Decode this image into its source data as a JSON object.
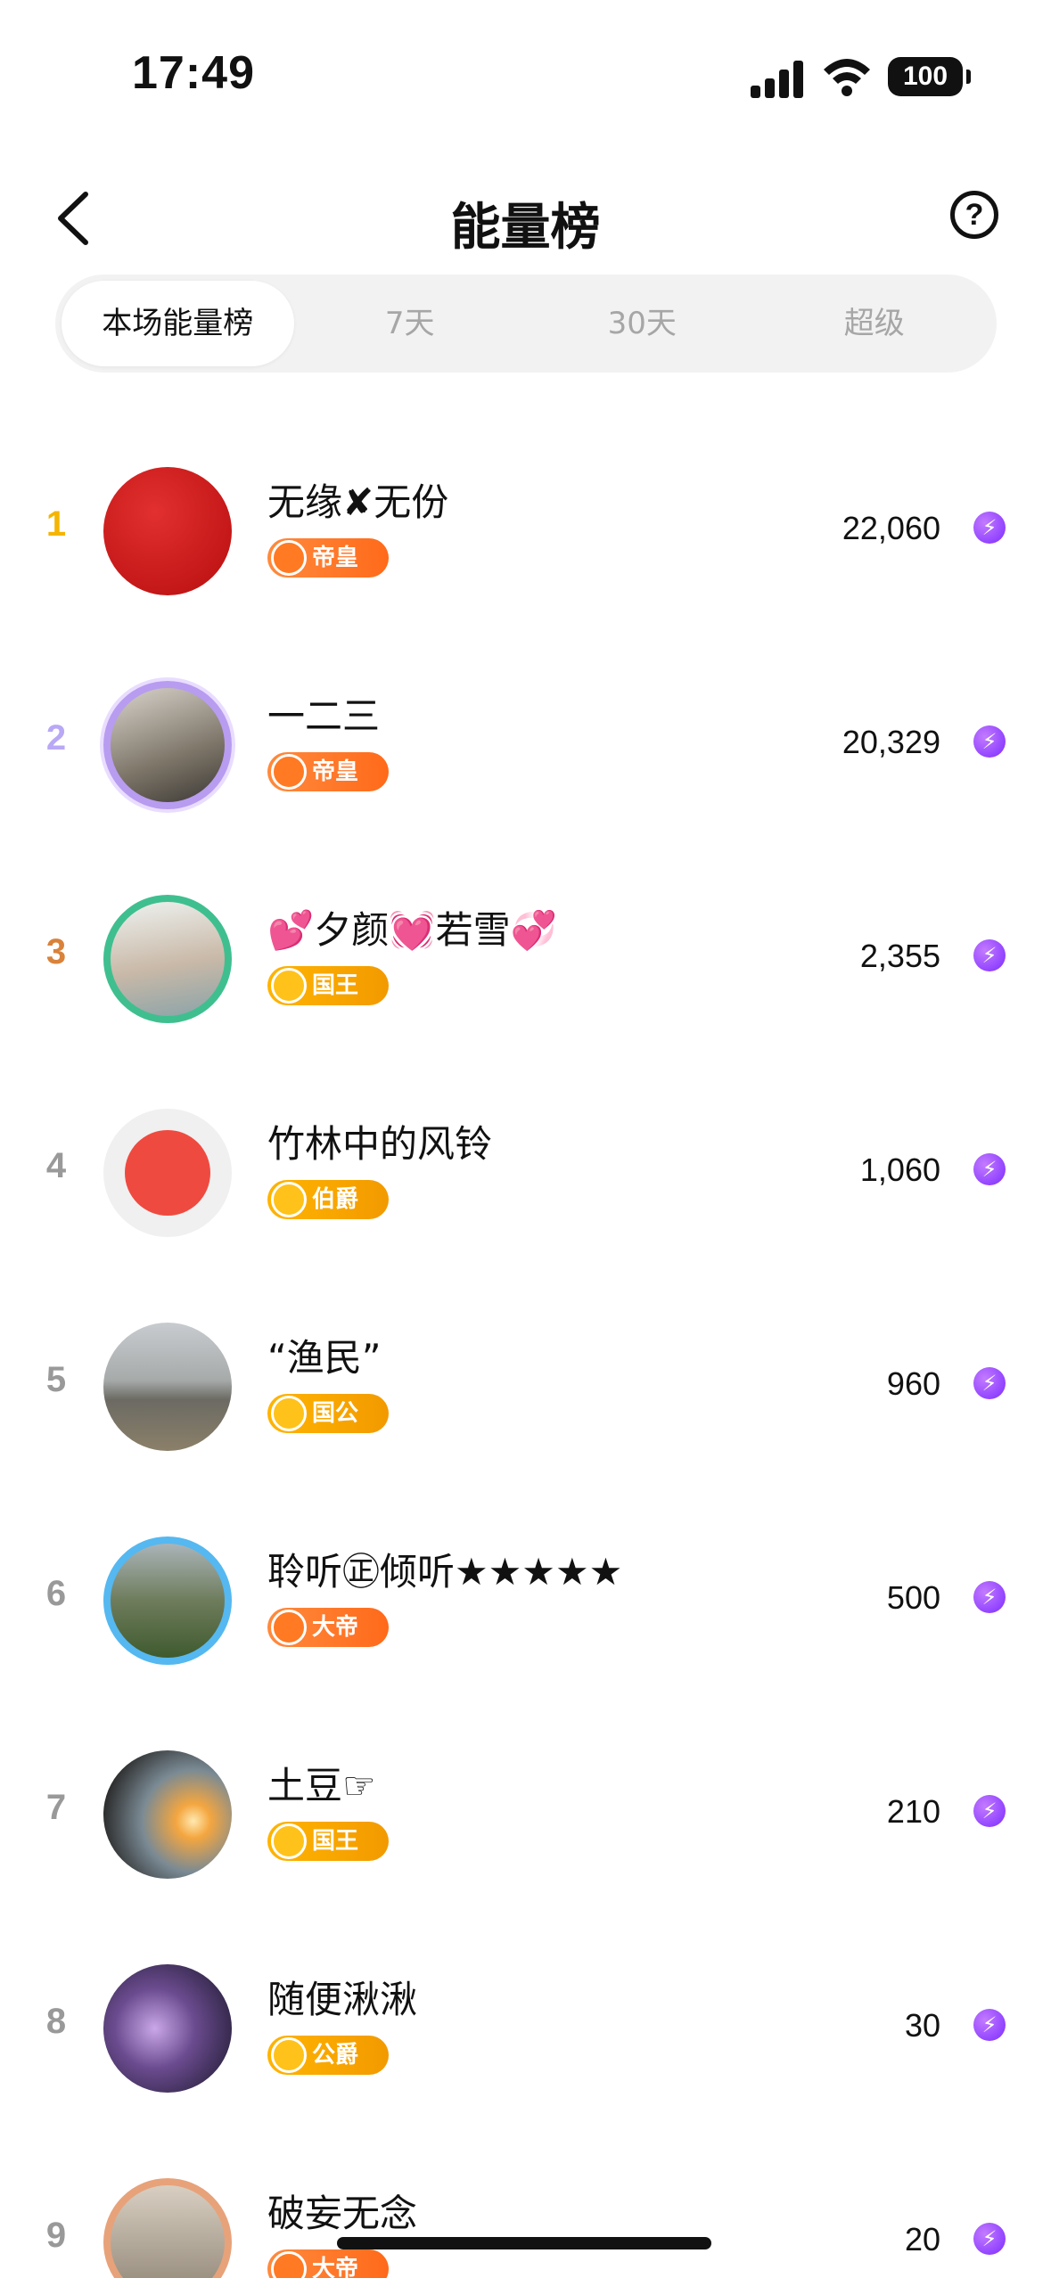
{
  "status_bar": {
    "time": "17:49",
    "battery": "100"
  },
  "nav": {
    "title": "能量榜",
    "help_symbol": "?"
  },
  "tabs": [
    {
      "label": "本场能量榜",
      "active": true
    },
    {
      "label": "7天",
      "active": false
    },
    {
      "label": "30天",
      "active": false
    },
    {
      "label": "超级",
      "active": false
    }
  ],
  "rankings": [
    {
      "rank": "1",
      "rank_color": "#f5b400",
      "name": "无缘✘无份",
      "badge": "帝皇",
      "badge_style": "orange",
      "score": "22,060"
    },
    {
      "rank": "2",
      "rank_color": "#b9a8f5",
      "name": "一二三",
      "badge": "帝皇",
      "badge_style": "orange",
      "score": "20,329"
    },
    {
      "rank": "3",
      "rank_color": "#d9823a",
      "name": "💕夕颜💓若雪💞",
      "badge": "国王",
      "badge_style": "gold",
      "score": "2,355"
    },
    {
      "rank": "4",
      "rank_color": "#999999",
      "name": "竹林中的风铃",
      "badge": "伯爵",
      "badge_style": "gold",
      "score": "1,060"
    },
    {
      "rank": "5",
      "rank_color": "#999999",
      "name": "“渔民”",
      "badge": "国公",
      "badge_style": "gold",
      "score": "960"
    },
    {
      "rank": "6",
      "rank_color": "#999999",
      "name": "聆听㊣倾听★★★★★",
      "badge": "大帝",
      "badge_style": "orange",
      "score": "500"
    },
    {
      "rank": "7",
      "rank_color": "#999999",
      "name": "土豆☞",
      "badge": "国王",
      "badge_style": "gold",
      "score": "210"
    },
    {
      "rank": "8",
      "rank_color": "#999999",
      "name": "随便湫湫",
      "badge": "公爵",
      "badge_style": "gold",
      "score": "30"
    },
    {
      "rank": "9",
      "rank_color": "#999999",
      "name": "破妄无念",
      "badge": "大帝",
      "badge_style": "orange",
      "score": "20"
    }
  ],
  "icons": {
    "back": "chevron-left-icon",
    "help": "question-circle-icon",
    "energy": "lightning-bolt-icon",
    "signal": "cellular-signal-icon",
    "wifi": "wifi-icon"
  },
  "colors": {
    "badge_orange": "#ff7a22",
    "badge_gold": "#ffb400",
    "energy_purple": "#7c2cff",
    "tab_bg": "#f2f2f2"
  }
}
